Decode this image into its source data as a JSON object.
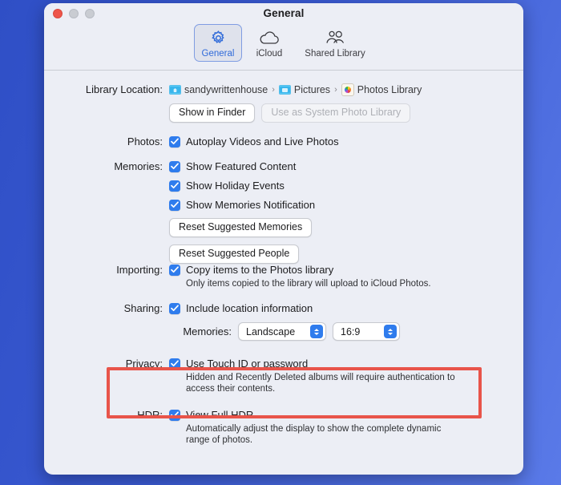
{
  "window": {
    "title": "General",
    "traffic_lights": [
      "close-button",
      "minimize-button",
      "zoom-button"
    ]
  },
  "toolbar": {
    "tabs": [
      {
        "label": "General",
        "icon": "gear-icon",
        "selected": true
      },
      {
        "label": "iCloud",
        "icon": "cloud-icon",
        "selected": false
      },
      {
        "label": "Shared Library",
        "icon": "people-icon",
        "selected": false
      }
    ]
  },
  "library_location": {
    "label": "Library Location:",
    "breadcrumb": [
      {
        "name": "sandywrittenhouse",
        "icon": "home-folder-icon"
      },
      {
        "name": "Pictures",
        "icon": "folder-icon"
      },
      {
        "name": "Photos Library",
        "icon": "photos-library-icon"
      }
    ],
    "separator": "›",
    "buttons": [
      {
        "label": "Show in Finder",
        "disabled": false
      },
      {
        "label": "Use as System Photo Library",
        "disabled": true
      }
    ]
  },
  "photos": {
    "label": "Photos:",
    "options": [
      {
        "text": "Autoplay Videos and Live Photos",
        "checked": true
      }
    ]
  },
  "memories": {
    "label": "Memories:",
    "options": [
      {
        "text": "Show Featured Content",
        "checked": true
      },
      {
        "text": "Show Holiday Events",
        "checked": true
      },
      {
        "text": "Show Memories Notification",
        "checked": true
      }
    ],
    "buttons": [
      {
        "label": "Reset Suggested Memories"
      },
      {
        "label": "Reset Suggested People"
      }
    ]
  },
  "importing": {
    "label": "Importing:",
    "option": {
      "text": "Copy items to the Photos library",
      "checked": true
    },
    "description": "Only items copied to the library will upload to iCloud Photos."
  },
  "sharing": {
    "label": "Sharing:",
    "option": {
      "text": "Include location information",
      "checked": true
    },
    "memories_label": "Memories:",
    "orientation_value": "Landscape",
    "aspect_ratio_value": "16:9"
  },
  "privacy": {
    "label": "Privacy:",
    "option": {
      "text": "Use Touch ID or password",
      "checked": true
    },
    "description": "Hidden and Recently Deleted albums will require authentication to access their contents.",
    "highlight_color": "#e8544a"
  },
  "hdr": {
    "label": "HDR:",
    "option": {
      "text": "View Full HDR",
      "checked": true
    },
    "description": "Automatically adjust the display to show the complete dynamic range of photos."
  },
  "colors": {
    "accent": "#2f7ced",
    "desktop_background": "#3a5ad2",
    "window_background": "#eceef5"
  }
}
